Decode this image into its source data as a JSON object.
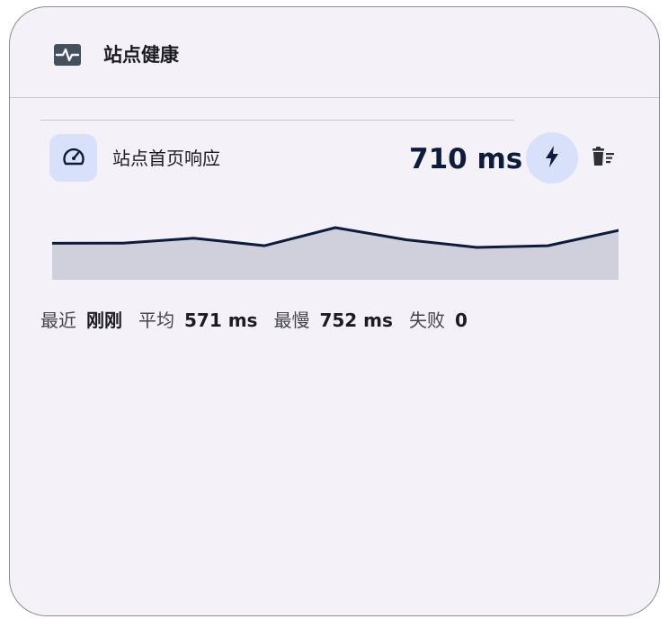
{
  "card": {
    "title": "站点健康",
    "title_icon": "heartbeat-monitor-icon"
  },
  "monitor": {
    "name": "站点首页响应",
    "value": "710 ms",
    "icon": "speedometer-icon",
    "actions": {
      "check_now_icon": "lightning-bolt-icon",
      "delete_icon": "trash-sweep-icon"
    },
    "sparkline_ms": [
      649,
      650,
      690,
      630,
      774,
      677,
      616,
      630,
      752
    ],
    "colors": {
      "line": "#0d1b3d",
      "fill": "#cfd0db",
      "accent_bg": "#d9e1fa"
    }
  },
  "stats": [
    {
      "label": "最近",
      "value": "刚刚"
    },
    {
      "label": "平均",
      "value": "571 ms"
    },
    {
      "label": "最慢",
      "value": "752 ms"
    },
    {
      "label": "失败",
      "value": "0"
    }
  ]
}
